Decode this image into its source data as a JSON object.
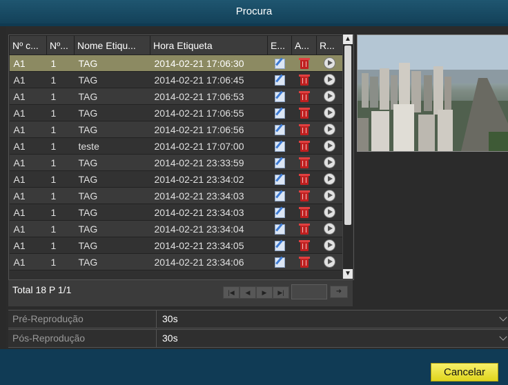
{
  "window": {
    "title": "Procura"
  },
  "table": {
    "columns": [
      "Nº c...",
      "Nº...",
      "Nome Etiqu...",
      "Hora Etiqueta",
      "E...",
      "A...",
      "R..."
    ],
    "rows": [
      {
        "channel": "A1",
        "num": "1",
        "name": "TAG",
        "time": "2014-02-21 17:06:30"
      },
      {
        "channel": "A1",
        "num": "1",
        "name": "TAG",
        "time": "2014-02-21 17:06:45"
      },
      {
        "channel": "A1",
        "num": "1",
        "name": "TAG",
        "time": "2014-02-21 17:06:53"
      },
      {
        "channel": "A1",
        "num": "1",
        "name": "TAG",
        "time": "2014-02-21 17:06:55"
      },
      {
        "channel": "A1",
        "num": "1",
        "name": "TAG",
        "time": "2014-02-21 17:06:56"
      },
      {
        "channel": "A1",
        "num": "1",
        "name": "teste",
        "time": "2014-02-21 17:07:00"
      },
      {
        "channel": "A1",
        "num": "1",
        "name": "TAG",
        "time": "2014-02-21 23:33:59"
      },
      {
        "channel": "A1",
        "num": "1",
        "name": "TAG",
        "time": "2014-02-21 23:34:02"
      },
      {
        "channel": "A1",
        "num": "1",
        "name": "TAG",
        "time": "2014-02-21 23:34:03"
      },
      {
        "channel": "A1",
        "num": "1",
        "name": "TAG",
        "time": "2014-02-21 23:34:03"
      },
      {
        "channel": "A1",
        "num": "1",
        "name": "TAG",
        "time": "2014-02-21 23:34:04"
      },
      {
        "channel": "A1",
        "num": "1",
        "name": "TAG",
        "time": "2014-02-21 23:34:05"
      },
      {
        "channel": "A1",
        "num": "1",
        "name": "TAG",
        "time": "2014-02-21 23:34:06"
      }
    ],
    "selected_row": 0,
    "row_icons": [
      "edit-icon",
      "trash-icon",
      "play-icon"
    ]
  },
  "pager": {
    "total_label": "Total 18 P 1/1",
    "nav_icons": [
      "first-page-icon",
      "prev-page-icon",
      "next-page-icon",
      "last-page-icon"
    ],
    "go_icon": "go-arrow-icon"
  },
  "settings": {
    "pre_label": "Pré-Reprodução",
    "pre_value": "30s",
    "post_label": "Pós-Reprodução",
    "post_value": "30s"
  },
  "buttons": {
    "cancel_label": "Cancelar"
  },
  "colors": {
    "title_bar": "#1a4d66",
    "selected_row": "#8c8a62",
    "cancel_button": "#efe63a"
  }
}
